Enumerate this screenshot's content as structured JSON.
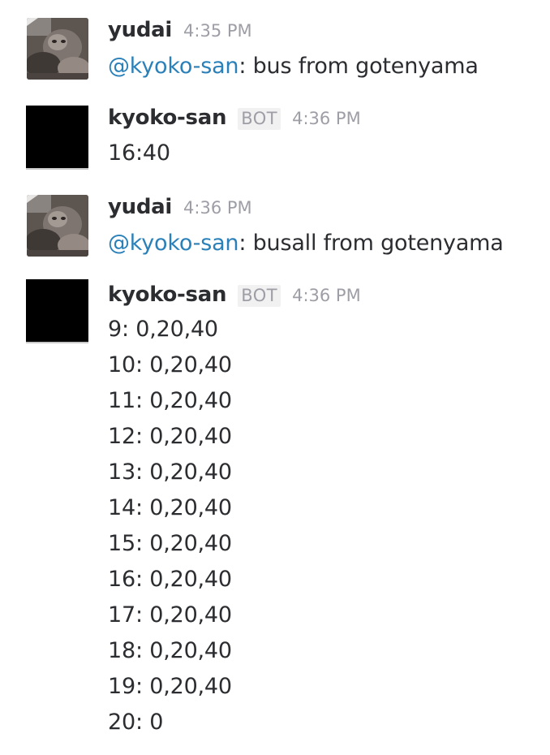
{
  "messages": [
    {
      "username": "yudai",
      "timestamp": "4:35 PM",
      "mention": "@kyoko-san",
      "text": ": bus from gotenyama"
    },
    {
      "username": "kyoko-san",
      "badge": "BOT",
      "timestamp": "4:36 PM",
      "lines": [
        "16:40"
      ]
    },
    {
      "username": "yudai",
      "timestamp": "4:36 PM",
      "mention": "@kyoko-san",
      "text": ": busall from gotenyama"
    },
    {
      "username": "kyoko-san",
      "badge": "BOT",
      "timestamp": "4:36 PM",
      "lines": [
        "9: 0,20,40",
        "10: 0,20,40",
        "11: 0,20,40",
        "12: 0,20,40",
        "13: 0,20,40",
        "14: 0,20,40",
        "15: 0,20,40",
        "16: 0,20,40",
        "17: 0,20,40",
        "18: 0,20,40",
        "19: 0,20,40",
        "20: 0"
      ]
    }
  ]
}
